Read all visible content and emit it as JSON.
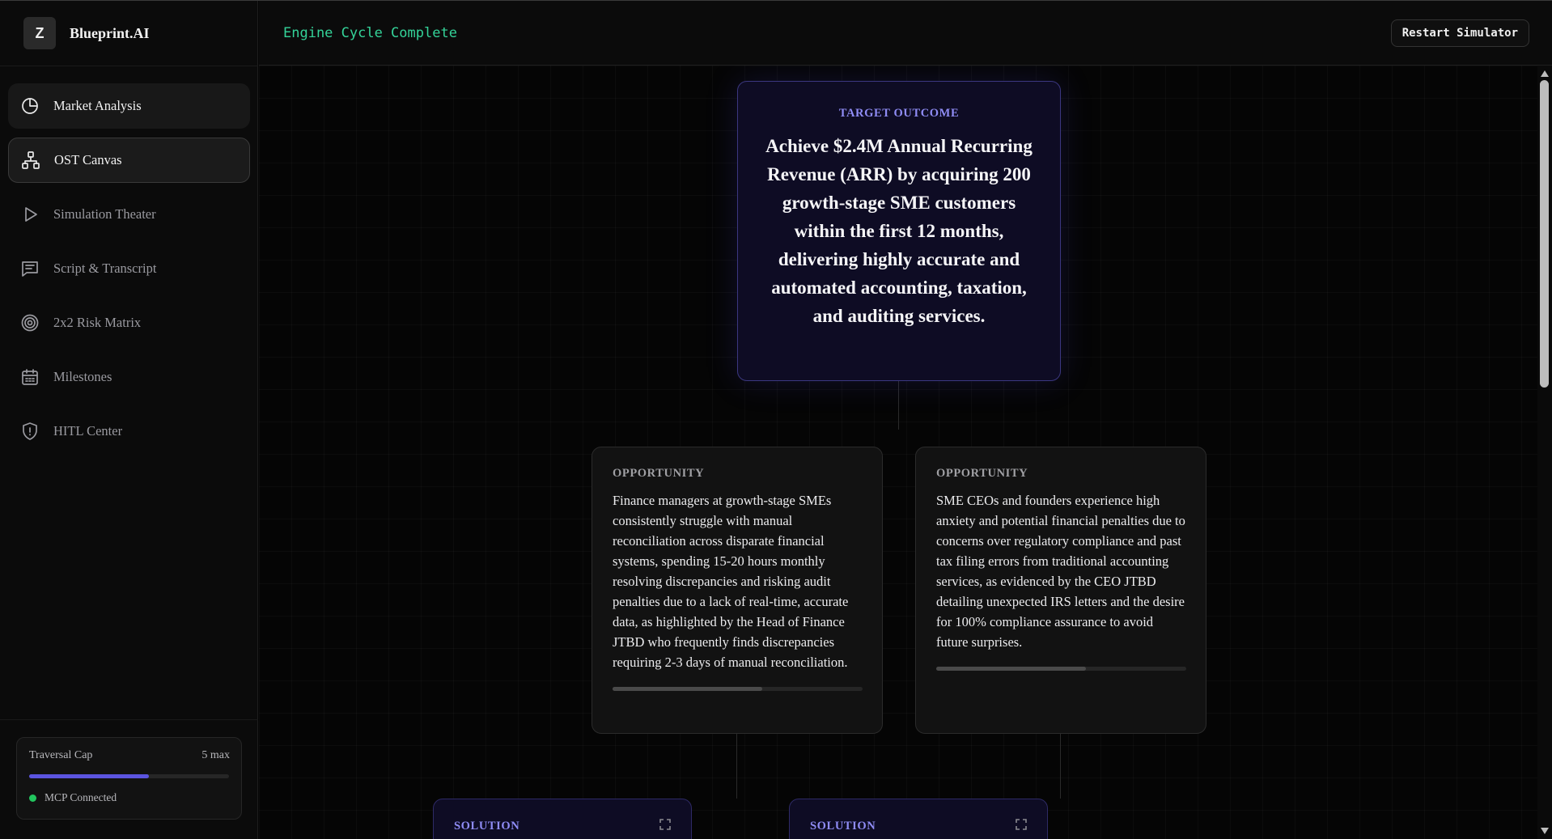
{
  "app": {
    "logo_letter": "Z",
    "name": "Blueprint.AI"
  },
  "header": {
    "status": "Engine Cycle Complete",
    "restart_label": "Restart Simulator"
  },
  "sidebar": {
    "items": [
      {
        "label": "Market Analysis",
        "icon": "pie-chart-icon",
        "state": "hover"
      },
      {
        "label": "OST Canvas",
        "icon": "sitemap-icon",
        "state": "active"
      },
      {
        "label": "Simulation Theater",
        "icon": "play-icon",
        "state": "normal"
      },
      {
        "label": "Script & Transcript",
        "icon": "message-square-text-icon",
        "state": "normal"
      },
      {
        "label": "2x2 Risk Matrix",
        "icon": "target-icon",
        "state": "normal"
      },
      {
        "label": "Milestones",
        "icon": "calendar-icon",
        "state": "normal"
      },
      {
        "label": "HITL Center",
        "icon": "shield-alert-icon",
        "state": "normal"
      }
    ],
    "traversal": {
      "label": "Traversal Cap",
      "max_label": "5 max",
      "progress": 0.6
    },
    "connection": {
      "label": "MCP Connected",
      "color": "#22c55e"
    }
  },
  "canvas": {
    "goal": {
      "tag": "TARGET OUTCOME",
      "text": "Achieve $2.4M Annual Recurring Revenue (ARR) by acquiring 200 growth-stage SME customers within the first 12 months, delivering highly accurate and automated accounting, taxation, and auditing services."
    },
    "opportunities": [
      {
        "tag": "OPPORTUNITY",
        "text": "Finance managers at growth-stage SMEs consistently struggle with manual reconciliation across disparate financial systems, spending 15-20 hours monthly resolving discrepancies and risking audit penalties due to a lack of real-time, accurate data, as highlighted by the Head of Finance JTBD who frequently finds discrepancies requiring 2-3 days of manual reconciliation.",
        "score": 0.6
      },
      {
        "tag": "OPPORTUNITY",
        "text": "SME CEOs and founders experience high anxiety and potential financial penalties due to concerns over regulatory compliance and past tax filing errors from traditional accounting services, as evidenced by the CEO JTBD detailing unexpected IRS letters and the desire for 100% compliance assurance to avoid future surprises.",
        "score": 0.6
      }
    ],
    "solutions": [
      {
        "tag": "SOLUTION",
        "icon": "expand-icon"
      },
      {
        "tag": "SOLUTION",
        "icon": "expand-icon"
      }
    ]
  },
  "colors": {
    "accent": "#5b54e0",
    "status": "#34d399",
    "background": "#050505"
  }
}
